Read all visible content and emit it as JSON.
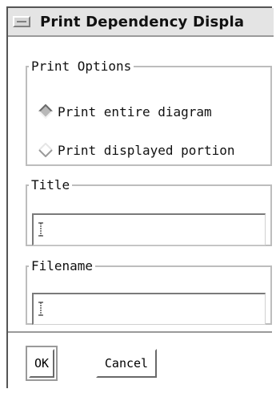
{
  "window": {
    "title": "Print Dependency Displa"
  },
  "print_options": {
    "legend": "Print Options",
    "options": [
      {
        "label": "Print entire diagram",
        "selected": true
      },
      {
        "label": "Print displayed portion",
        "selected": false
      }
    ]
  },
  "title_group": {
    "legend": "Title",
    "value": ""
  },
  "filename_group": {
    "legend": "Filename",
    "value": ""
  },
  "buttons": {
    "ok_label": "OK",
    "cancel_label": "Cancel"
  },
  "icons": {
    "window_menu": "window-menu-icon",
    "radio_selected": "diamond-radio-selected-icon",
    "radio_unselected": "diamond-radio-unselected-icon",
    "text_cursor": "ibeam-cursor-icon"
  },
  "colors": {
    "titlebar_bg": "#e4e4e4",
    "frame": "#bdbdbd",
    "radio_selected": "#b8b8b8",
    "radio_unselected": "#d2d2d2"
  }
}
